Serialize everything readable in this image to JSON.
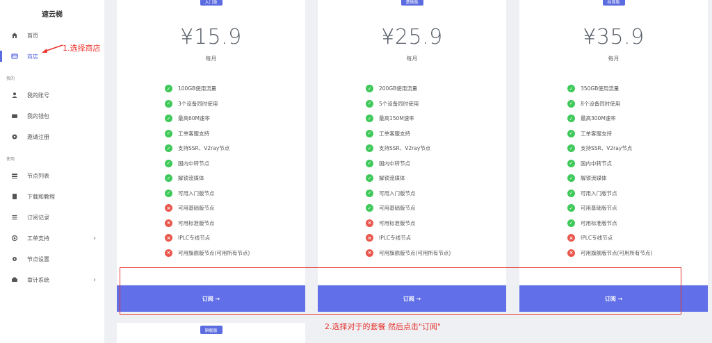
{
  "sidebar": {
    "brand": "速云梯",
    "items": [
      {
        "label": "首页",
        "icon": "home-icon"
      },
      {
        "label": "商店",
        "icon": "store-icon"
      },
      {
        "label": "我的账号",
        "icon": "user-icon"
      },
      {
        "label": "我的钱包",
        "icon": "wallet-icon"
      },
      {
        "label": "邀请注册",
        "icon": "invite-icon"
      },
      {
        "label": "节点列表",
        "icon": "server-icon"
      },
      {
        "label": "下载和教程",
        "icon": "book-icon"
      },
      {
        "label": "订阅记录",
        "icon": "list-icon"
      },
      {
        "label": "工单支持",
        "icon": "support-icon",
        "chevron": "›"
      },
      {
        "label": "节点设置",
        "icon": "gear-icon"
      },
      {
        "label": "审计系统",
        "icon": "audit-icon",
        "chevron": "›"
      }
    ],
    "sections": [
      "我的",
      "使用"
    ]
  },
  "plans": [
    {
      "badge": "入门版",
      "price": "¥15.9",
      "period": "每月",
      "button": "订阅 →",
      "features": [
        {
          "text": "100GB使用流量",
          "ok": true
        },
        {
          "text": "3个设备同时使用",
          "ok": true
        },
        {
          "text": "最高60M速率",
          "ok": true
        },
        {
          "text": "工单客服支持",
          "ok": true
        },
        {
          "text": "支持SSR、V2ray节点",
          "ok": true
        },
        {
          "text": "国内中转节点",
          "ok": true
        },
        {
          "text": "解锁流媒体",
          "ok": true
        },
        {
          "text": "可用入门版节点",
          "ok": true
        },
        {
          "text": "可用基础版节点",
          "ok": false
        },
        {
          "text": "可用标准版节点",
          "ok": false
        },
        {
          "text": "IPLC专线节点",
          "ok": false
        },
        {
          "text": "可用旗舰版节点(可用所有节点)",
          "ok": false
        }
      ]
    },
    {
      "badge": "基础版",
      "price": "¥25.9",
      "period": "每月",
      "button": "订阅 →",
      "features": [
        {
          "text": "200GB使用流量",
          "ok": true
        },
        {
          "text": "5个设备同时使用",
          "ok": true
        },
        {
          "text": "最高150M速率",
          "ok": true
        },
        {
          "text": "工单客服支持",
          "ok": true
        },
        {
          "text": "支持SSR、V2ray节点",
          "ok": true
        },
        {
          "text": "国内中转节点",
          "ok": true
        },
        {
          "text": "解锁流媒体",
          "ok": true
        },
        {
          "text": "可用入门版节点",
          "ok": true
        },
        {
          "text": "可用基础版节点",
          "ok": true
        },
        {
          "text": "可用标准版节点",
          "ok": false
        },
        {
          "text": "IPLC专线节点",
          "ok": false
        },
        {
          "text": "可用旗舰版节点(可用所有节点)",
          "ok": false
        }
      ]
    },
    {
      "badge": "标准版",
      "price": "¥35.9",
      "period": "每月",
      "button": "订阅 →",
      "features": [
        {
          "text": "350GB使用流量",
          "ok": true
        },
        {
          "text": "8个设备同时使用",
          "ok": true
        },
        {
          "text": "最高300M速率",
          "ok": true
        },
        {
          "text": "工单客服支持",
          "ok": true
        },
        {
          "text": "支持SSR、V2ray节点",
          "ok": true
        },
        {
          "text": "国内中转节点",
          "ok": true
        },
        {
          "text": "解锁流媒体",
          "ok": true
        },
        {
          "text": "可用入门版节点",
          "ok": true
        },
        {
          "text": "可用基础版节点",
          "ok": true
        },
        {
          "text": "可用标准版节点",
          "ok": true
        },
        {
          "text": "IPLC专线节点",
          "ok": false
        },
        {
          "text": "可用旗舰版节点(可用所有节点)",
          "ok": false
        }
      ]
    }
  ],
  "next_plan_badge": "旗舰版",
  "annotations": {
    "step1": "1.选择商店",
    "step2": "2.选择对于的套餐  然后点击\"订阅\""
  },
  "colors": {
    "accent": "#6170e8",
    "ok": "#3fc95a",
    "no": "#e9574d",
    "annotation": "#e8322b"
  }
}
